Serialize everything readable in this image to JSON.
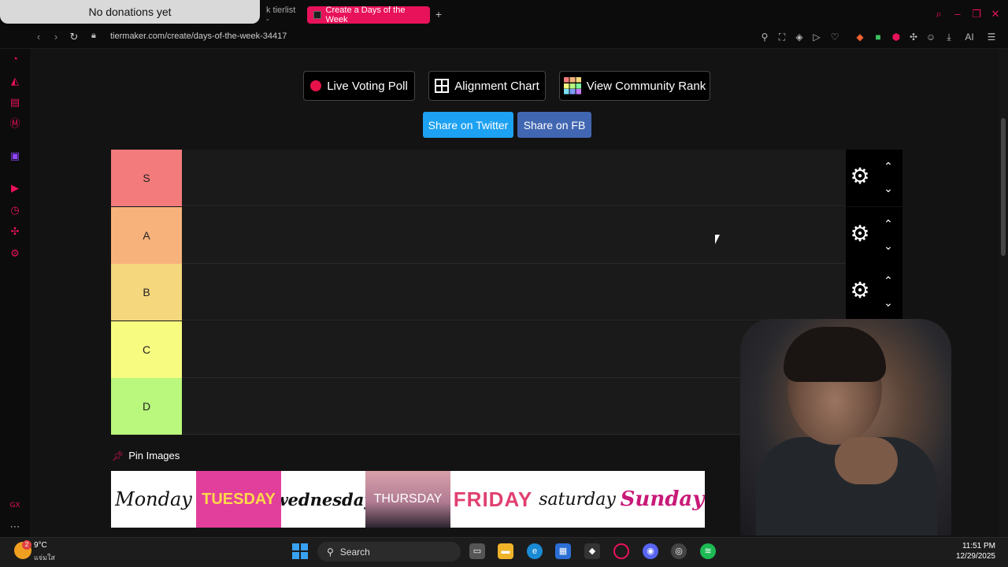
{
  "overlay": {
    "donations": "No donations yet"
  },
  "browser": {
    "tabs": [
      {
        "label": "k tierlist -"
      },
      {
        "label": "Create a Days of the Week"
      }
    ],
    "url": "tiermaker.com/create/days-of-the-week-34417",
    "ai_label": "AI"
  },
  "toolbar": {
    "live_voting": "Live Voting Poll",
    "alignment": "Alignment Chart",
    "community": "View Community Rank",
    "share_twitter": "Share on Twitter",
    "share_fb": "Share on FB"
  },
  "tiers": [
    {
      "label": "S",
      "color": "#f47b7b"
    },
    {
      "label": "A",
      "color": "#f7b27c"
    },
    {
      "label": "B",
      "color": "#f5d77e"
    },
    {
      "label": "C",
      "color": "#f7fb80"
    },
    {
      "label": "D",
      "color": "#b9f77d"
    }
  ],
  "pin_images": {
    "label": "Pin Images"
  },
  "days": [
    "Monday",
    "TUESDAY",
    "wednesday",
    "THURSDAY",
    "FRIDAY",
    "saturday",
    "Sunday"
  ],
  "taskbar": {
    "temperature": "9°C",
    "condition": "แจ่มใส",
    "weather_badge": "2",
    "search_placeholder": "Search",
    "time": "11:51 PM",
    "date": "12/29/2025"
  },
  "colors": {
    "accent": "#e8125b",
    "twitter": "#1da1f2",
    "facebook": "#4267b2"
  }
}
